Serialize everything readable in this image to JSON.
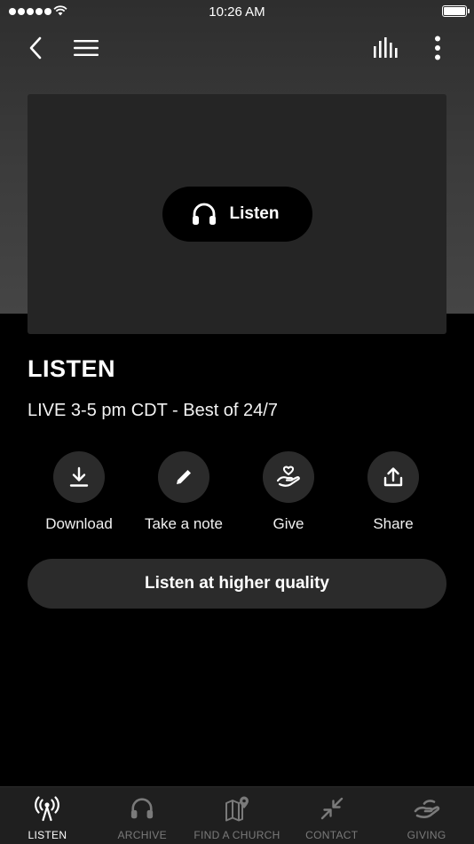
{
  "status_bar": {
    "time": "10:26 AM"
  },
  "header": {
    "icons": [
      "back-icon",
      "hamburger-menu-icon",
      "equalizer-icon",
      "more-vertical-icon"
    ]
  },
  "player": {
    "listen_label": "Listen",
    "icon": "headphones-icon"
  },
  "main": {
    "title": "LISTEN",
    "subtitle": "LIVE 3-5 pm CDT - Best of 24/7",
    "actions": [
      {
        "label": "Download",
        "icon": "download-icon"
      },
      {
        "label": "Take a note",
        "icon": "pencil-icon"
      },
      {
        "label": "Give",
        "icon": "giving-hand-icon"
      },
      {
        "label": "Share",
        "icon": "share-icon"
      }
    ],
    "quality_label": "Listen at higher quality"
  },
  "tabs": [
    {
      "label": "LISTEN",
      "icon": "broadcast-icon",
      "active": true
    },
    {
      "label": "ARCHIVE",
      "icon": "headphones-icon",
      "active": false
    },
    {
      "label": "FIND A CHURCH",
      "icon": "map-pin-icon",
      "active": false
    },
    {
      "label": "CONTACT",
      "icon": "contact-arrows-icon",
      "active": false
    },
    {
      "label": "GIVING",
      "icon": "giving-hand-icon",
      "active": false
    }
  ],
  "colors": {
    "background": "#000000",
    "card": "#252525",
    "button": "#2b2b2b",
    "tab_bar": "#1f1f1f",
    "tab_active": "#ffffff",
    "tab_inactive": "#7a7a7a"
  }
}
